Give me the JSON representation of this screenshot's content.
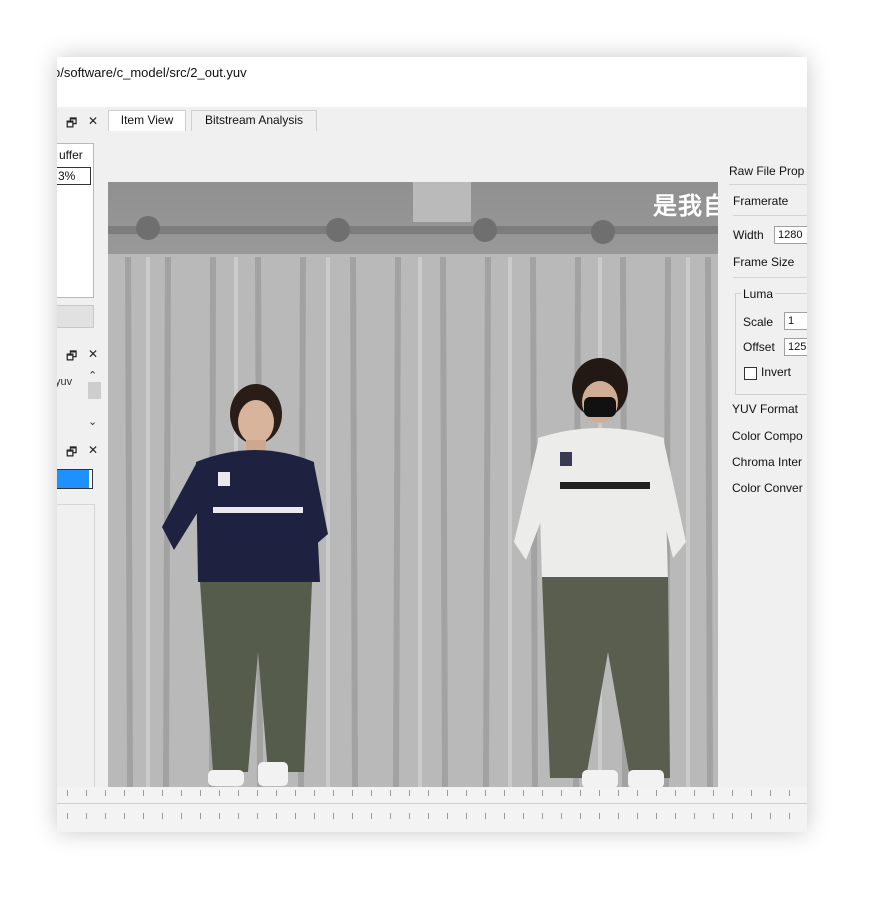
{
  "window": {
    "title_path": "o/software/c_model/src/2_out.yuv"
  },
  "left_docks": {
    "top_dock": {
      "float_glyph": "🗗",
      "close_glyph": "✕",
      "buffer_label": "uffer",
      "percent_value": "3%"
    },
    "middle_dock": {
      "float_glyph": "🗗",
      "close_glyph": "✕",
      "file_item": "yuv",
      "scroll_up": "⌃",
      "scroll_down": "⌄"
    },
    "bottom_dock": {
      "float_glyph": "🗗",
      "close_glyph": "✕"
    }
  },
  "tabs": [
    {
      "label": "Item View",
      "active": true
    },
    {
      "label": "Bitstream Analysis",
      "active": false
    }
  ],
  "video": {
    "overlay_text": "是我自"
  },
  "properties": {
    "header": "Raw File Prop",
    "framerate_label": "Framerate",
    "width_label": "Width",
    "width_value": "1280",
    "frame_size_label": "Frame Size",
    "luma_group": "Luma",
    "scale_label": "Scale",
    "scale_value": "1",
    "offset_label": "Offset",
    "offset_value": "125",
    "invert_label": "Invert",
    "invert_checked": false,
    "yuv_format_label": "YUV Format",
    "color_components_label": "Color Compo",
    "chroma_interp_label": "Chroma Inter",
    "color_conversion_label": "Color Conver"
  },
  "colors": {
    "progress_blue": "#1e90ff",
    "panel_bg": "#f0f0f0"
  }
}
